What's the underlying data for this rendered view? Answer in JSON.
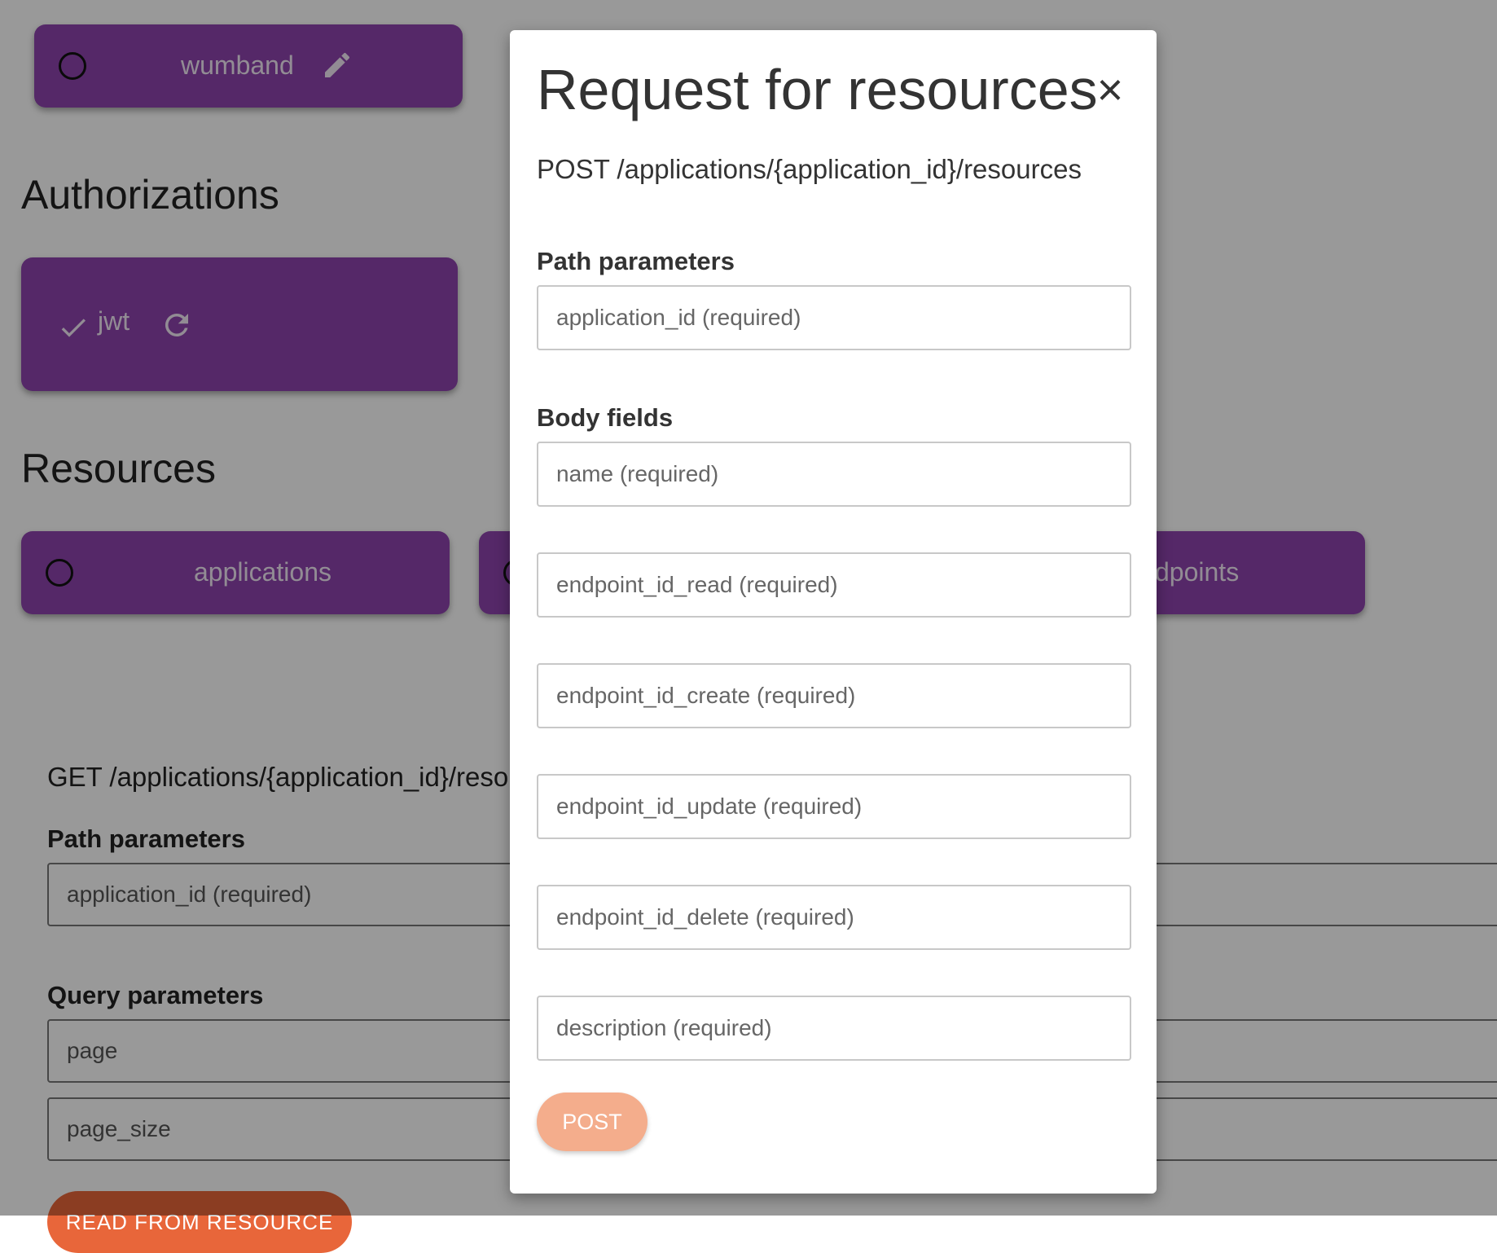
{
  "background": {
    "wumband_card": {
      "label": "wumband",
      "icons": [
        "radio-circle-icon",
        "pencil-icon"
      ]
    },
    "authorizations": {
      "title": "Authorizations",
      "jwt_card": {
        "label": "jwt",
        "icons": [
          "check-icon",
          "refresh-icon"
        ]
      }
    },
    "resources": {
      "title": "Resources",
      "cards": [
        {
          "label": "applications"
        },
        {
          "label": ""
        },
        {
          "label": "dpoints"
        }
      ]
    },
    "get_section": {
      "endpoint": "GET /applications/{application_id}/resou",
      "path_params_label": "Path parameters",
      "path_param_placeholder": "application_id (required)",
      "query_params_label": "Query parameters",
      "query_param_placeholders": [
        "page",
        "page_size"
      ],
      "button_label": "READ FROM RESOURCE"
    }
  },
  "modal": {
    "title": "Request for resources",
    "close_symbol": "×",
    "endpoint": "POST /applications/{application_id}/resources",
    "path_params_label": "Path parameters",
    "path_fields": [
      {
        "placeholder": "application_id (required)",
        "value": ""
      }
    ],
    "body_fields_label": "Body fields",
    "body_fields": [
      {
        "placeholder": "name (required)",
        "value": ""
      },
      {
        "placeholder": "endpoint_id_read (required)",
        "value": ""
      },
      {
        "placeholder": "endpoint_id_create (required)",
        "value": ""
      },
      {
        "placeholder": "endpoint_id_update (required)",
        "value": ""
      },
      {
        "placeholder": "endpoint_id_delete (required)",
        "value": ""
      },
      {
        "placeholder": "description (required)",
        "value": ""
      }
    ],
    "submit_label": "POST"
  },
  "colors": {
    "card_purple": "#8e44ad",
    "overlay": "rgba(0,0,0,0.4)",
    "post_button": "#f4ad8c",
    "read_button": "#e8663a"
  }
}
